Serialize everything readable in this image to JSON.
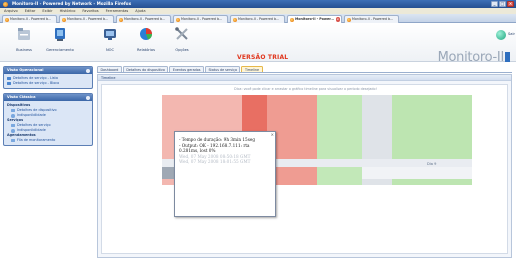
{
  "window": {
    "title": "Monitoro-II - Powered by Network - Mozilla Firefox"
  },
  "menu": [
    "Arquivo",
    "Editar",
    "Exibir",
    "Histórico",
    "Favoritos",
    "Ferramentas",
    "Ajuda"
  ],
  "browser_tabs": [
    {
      "label": "Monitoro-II - Powered b..."
    },
    {
      "label": "Monitoro-II - Powered b..."
    },
    {
      "label": "Monitoro-II - Powered b..."
    },
    {
      "label": "Monitoro-II - Powered b..."
    },
    {
      "label": "Monitoro-II - Powered b..."
    },
    {
      "label": "Monitoro-II - Power..."
    },
    {
      "label": "Monitoro-II - Powered b..."
    }
  ],
  "toolbar": {
    "items": [
      {
        "label": "Business"
      },
      {
        "label": "Gerenciamento"
      },
      {
        "label": "NOC"
      },
      {
        "label": "Relatórios"
      },
      {
        "label": "Opções"
      }
    ],
    "exit_label": "Sair",
    "trial_text": "VERSÃO TRIAL",
    "brand": "Monitoro-II"
  },
  "sidebar": {
    "panels": [
      {
        "title": "Visão Operacional",
        "items": [
          {
            "label": "Detalhes de serviço - Lista"
          },
          {
            "label": "Detalhes de serviço - Bloco"
          }
        ]
      },
      {
        "title": "Visão Clássica",
        "groups": [
          {
            "title": "Dispositivos",
            "items": [
              {
                "label": "Detalhes de dispositivo"
              },
              {
                "label": "Indisponibilidade",
                "warn": true
              }
            ]
          },
          {
            "title": "Serviços",
            "items": [
              {
                "label": "Detalhes de serviço"
              },
              {
                "label": "Indisponibilidade",
                "warn": true
              }
            ]
          },
          {
            "title": "Agendamentos",
            "items": [
              {
                "label": "Fila de monitoramento"
              }
            ]
          }
        ]
      }
    ]
  },
  "content": {
    "tabs": [
      "Dashboard",
      "Detalhes do dispositivo",
      "Eventos gerados",
      "Status de serviço",
      "Timeline"
    ],
    "panel_title": "Timeline",
    "hint": "Dica: você pode clicar e arrastar o gráfico timeline para visualizar o período desejado!",
    "day_label": "Dia 9",
    "tooltip": {
      "lines": [
        "- Tempo de duração: 9h 3min 15seg",
        "- Output: OK - 192.168.7.111: rta",
        "0.281ms, lost 0%",
        "Wed, 07 May 2008 08:50:18 GMT",
        "Wed, 07 May 2008 18:01:55 GMT"
      ]
    }
  }
}
